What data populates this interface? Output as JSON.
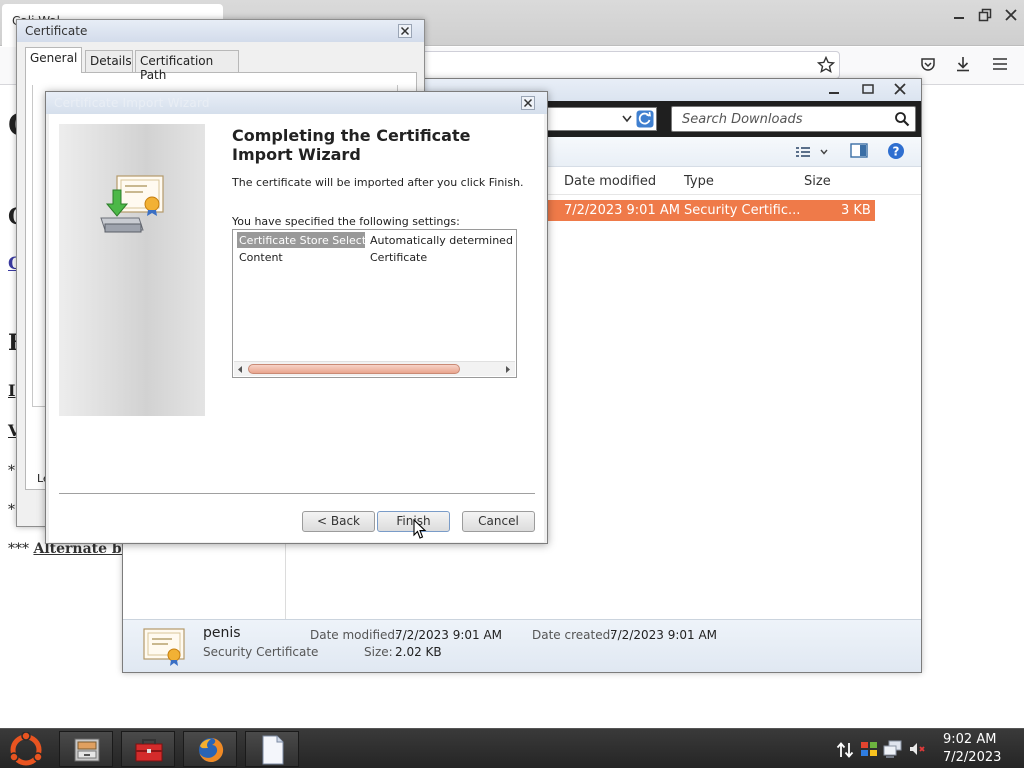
{
  "browser": {
    "tab_title": "Cali Wal..."
  },
  "page": {
    "letters": [
      "C",
      "C",
      "C",
      "F",
      "I",
      "V",
      "*",
      "*"
    ],
    "footer_prefix": "*** ",
    "footer_link": "Alternate bu"
  },
  "explorer": {
    "search_placeholder": "Search Downloads",
    "columns": [
      "Date modified",
      "Type",
      "Size"
    ],
    "selected_file": {
      "date_modified": "7/2/2023 9:01 AM",
      "type": "Security Certific...",
      "size": "3 KB"
    },
    "details": {
      "name": "penis",
      "kind": "Security Certificate",
      "date_modified_label": "Date modified:",
      "date_modified": "7/2/2023 9:01 AM",
      "size_label": "Size:",
      "size": "2.02 KB",
      "date_created_label": "Date created:",
      "date_created": "7/2/2023 9:01 AM"
    }
  },
  "cert_dialog": {
    "title": "Certificate",
    "tabs": [
      "General",
      "Details",
      "Certification Path"
    ],
    "partial_text": "Le"
  },
  "wizard": {
    "title": "Certificate Import Wizard",
    "heading": "Completing the Certificate Import Wizard",
    "info": "The certificate will be imported after you click Finish.",
    "settings_label": "You have specified the following settings:",
    "settings": [
      {
        "key": "Certificate Store Selected",
        "value": "Automatically determined by t"
      },
      {
        "key": "Content",
        "value": "Certificate"
      }
    ],
    "back": "< Back",
    "finish": "Finish",
    "cancel": "Cancel"
  },
  "taskbar": {
    "time": "9:02 AM",
    "date": "7/2/2023"
  },
  "colors": {
    "selection": "#ef7a49",
    "taskbar": "#2b2b2b",
    "ubuntu_orange": "#e95420"
  }
}
